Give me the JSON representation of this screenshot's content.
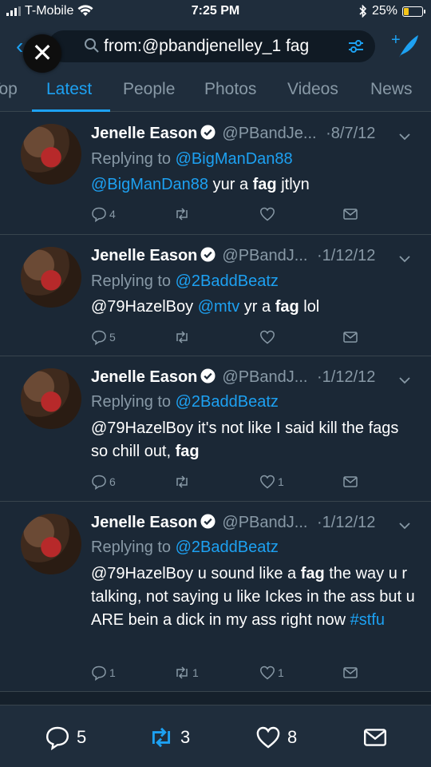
{
  "status_bar": {
    "carrier": "T-Mobile",
    "time": "7:25 PM",
    "battery": "25%",
    "battery_level": 0.25
  },
  "search": {
    "query": "from:@pbandjenelley_1 fag"
  },
  "tabs": [
    {
      "label": "Top"
    },
    {
      "label": "Latest"
    },
    {
      "label": "People"
    },
    {
      "label": "Photos"
    },
    {
      "label": "Videos"
    },
    {
      "label": "News"
    }
  ],
  "active_tab": "Latest",
  "tweets": [
    {
      "name": "Jenelle Eason",
      "handle": "@PBandJe...",
      "date": "·8/7/12",
      "replying_prefix": "Replying to",
      "replying_to": "@BigManDan88",
      "body_html": "<span class=\"link\">@BigManDan88</span> yur a <b>fag</b> jtlyn",
      "replies": "4",
      "retweets": "",
      "likes": ""
    },
    {
      "name": "Jenelle Eason",
      "handle": "@PBandJ...",
      "date": "·1/12/12",
      "replying_prefix": "Replying to",
      "replying_to": "@2BaddBeatz",
      "body_html": "@79HazelBoy <span class=\"link\">@mtv</span> yr a <b>fag</b> lol",
      "replies": "5",
      "retweets": "",
      "likes": ""
    },
    {
      "name": "Jenelle Eason",
      "handle": "@PBandJ...",
      "date": "·1/12/12",
      "replying_prefix": "Replying to",
      "replying_to": "@2BaddBeatz",
      "body_html": "@79HazelBoy it's not like I said kill the fags so chill out, <b>fag</b>",
      "replies": "6",
      "retweets": "",
      "likes": "1"
    },
    {
      "name": "Jenelle Eason",
      "handle": "@PBandJ...",
      "date": "·1/12/12",
      "replying_prefix": "Replying to",
      "replying_to": "@2BaddBeatz",
      "body_html": "@79HazelBoy u sound like a <b>fag</b> the way u r talking, not saying u like Ickes in the ass but u ARE bein a dick in my ass right now <span class=\"link\">#stfu</span>",
      "replies": "1",
      "retweets": "1",
      "likes": "1"
    }
  ],
  "bottom_bar": {
    "replies": "5",
    "retweets": "3",
    "likes": "8"
  },
  "colors": {
    "background": "#1b2836",
    "accent": "#1da1f2",
    "muted": "#8899a6"
  }
}
